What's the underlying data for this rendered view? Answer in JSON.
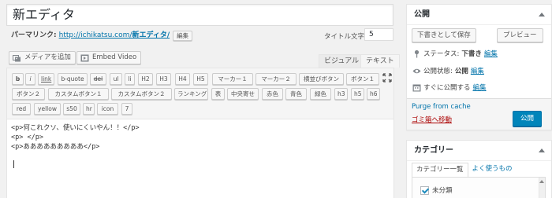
{
  "title": {
    "value": "新エディタ"
  },
  "permalink": {
    "label": "パーマリンク:",
    "url": "http://ichikatsu.com/",
    "slug": "新エディタ/",
    "edit_label": "編集"
  },
  "title_count": {
    "label": "タイトル文字数:",
    "value": "5"
  },
  "media": {
    "add_media": "メディアを追加",
    "embed_video": "Embed Video"
  },
  "editor_tabs": {
    "visual": "ビジュアル",
    "text": "テキスト"
  },
  "quicktags": {
    "row1": [
      "b",
      "i",
      "link",
      "b-quote",
      "del",
      "ul",
      "li",
      "H2",
      "H3",
      "H4",
      "H5",
      "マーカー１",
      "マーカー２",
      "横並びボタン",
      "ボタン１"
    ],
    "row2": [
      "ボタン２",
      "カスタムボタン１",
      "カスタムボタン２",
      "ランキング",
      "表",
      "中央寄せ",
      "赤色",
      "青色",
      "緑色",
      "h3",
      "h5",
      "h6"
    ],
    "row3": [
      "red",
      "yellow",
      "s50",
      "hr",
      "icon",
      "7"
    ]
  },
  "content": {
    "lines": [
      "<p>何これクソ、使いにくいやん！！</p>",
      "<p> </p>",
      "<p>あああああああああ</p>"
    ]
  },
  "publish": {
    "title": "公開",
    "save_draft": "下書きとして保存",
    "preview": "プレビュー",
    "status_label": "ステータス:",
    "status_value": "下書き",
    "visibility_label": "公開状態:",
    "visibility_value": "公開",
    "schedule_label": "すぐに公開する",
    "edit_label": "編集",
    "purge": "Purge from cache",
    "trash": "ゴミ箱へ移動",
    "publish_button": "公開"
  },
  "category": {
    "title": "カテゴリー",
    "tab_all": "カテゴリー一覧",
    "tab_popular": "よく使うもの",
    "items": [
      {
        "label": "未分類",
        "checked": true
      }
    ]
  },
  "colors": {
    "accent": "#0085ba",
    "link": "#0073aa",
    "trash": "#a00000"
  }
}
